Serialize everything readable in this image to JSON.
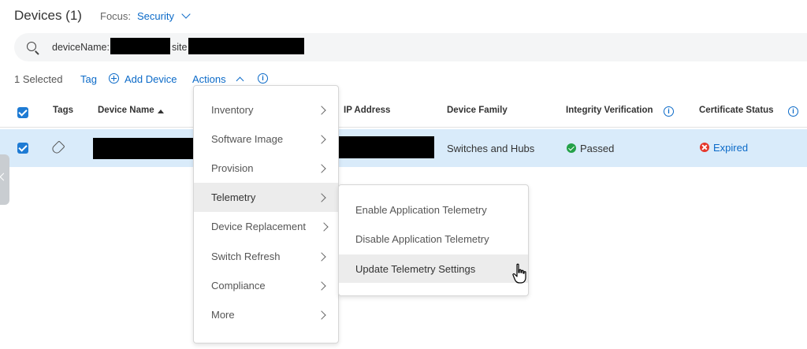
{
  "header": {
    "title": "Devices (1)",
    "focus_label": "Focus:",
    "focus_value": "Security"
  },
  "search": {
    "prefix1": "deviceName:",
    "prefix2": "site"
  },
  "toolbar": {
    "selected": "1 Selected",
    "tag": "Tag",
    "add_device": "Add Device",
    "actions": "Actions"
  },
  "table": {
    "columns": [
      "Tags",
      "Device Name",
      "IP Address",
      "Device Family",
      "Integrity Verification",
      "Certificate Status"
    ],
    "row": {
      "device_family": "Switches and Hubs",
      "integrity": "Passed",
      "certificate": "Expired"
    }
  },
  "actions_menu": {
    "items": [
      {
        "label": "Inventory"
      },
      {
        "label": "Software Image"
      },
      {
        "label": "Provision"
      },
      {
        "label": "Telemetry"
      },
      {
        "label": "Device Replacement"
      },
      {
        "label": "Switch Refresh"
      },
      {
        "label": "Compliance"
      },
      {
        "label": "More"
      }
    ]
  },
  "telemetry_submenu": {
    "items": [
      {
        "label": "Enable Application Telemetry"
      },
      {
        "label": "Disable Application Telemetry"
      },
      {
        "label": "Update Telemetry Settings"
      }
    ]
  },
  "colors": {
    "accent": "#0b6ac8",
    "row_selected": "#d9ebfa",
    "passed": "#24a148",
    "expired": "#e5372b"
  }
}
